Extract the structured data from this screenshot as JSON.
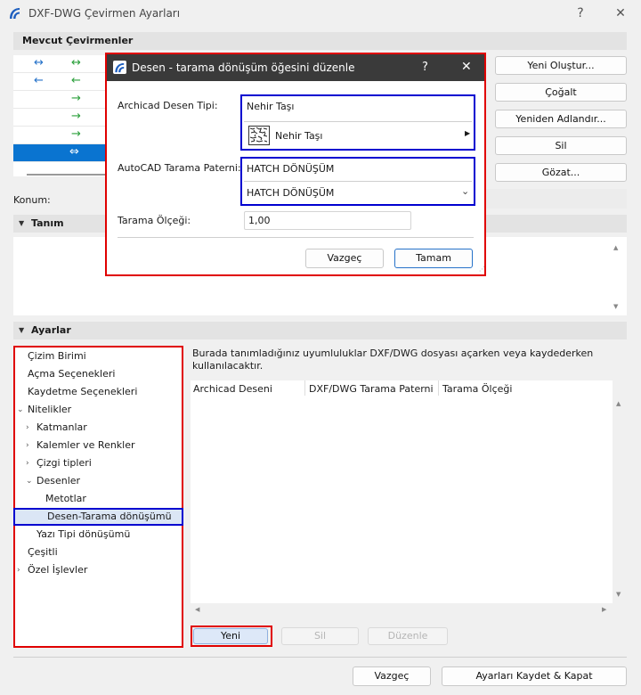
{
  "window": {
    "title": "DXF-DWG Çevirmen Ayarları",
    "help": "?",
    "close": "✕"
  },
  "current_translators": {
    "header": "Mevcut Çevirmenler",
    "rows": [
      {
        "icons": [
          "↔",
          "↔"
        ],
        "colors": [
          "#2672c9",
          "#2ca03c"
        ]
      },
      {
        "icons": [
          "←",
          "←"
        ],
        "colors": [
          "#2672c9",
          "#2ca03c"
        ]
      },
      {
        "icons": [
          "",
          "→"
        ],
        "colors": [
          "",
          "#2ca03c"
        ]
      },
      {
        "icons": [
          "",
          "→"
        ],
        "colors": [
          "",
          "#2ca03c"
        ]
      },
      {
        "icons": [
          "",
          "→"
        ],
        "colors": [
          "",
          "#2ca03c"
        ]
      },
      {
        "icons": [
          "",
          "⇔"
        ],
        "colors": [
          "",
          "#ffffff"
        ]
      }
    ],
    "buttons": {
      "new": "Yeni Oluştur...",
      "duplicate": "Çoğalt",
      "rename": "Yeniden Adlandır...",
      "delete": "Sil",
      "browse": "Gözat..."
    }
  },
  "location_label": "Konum:",
  "definition": {
    "header": "Tanım"
  },
  "settings": {
    "header": "Ayarlar",
    "nav": [
      {
        "label": "Çizim Birimi",
        "indent": 0,
        "chev": ""
      },
      {
        "label": "Açma Seçenekleri",
        "indent": 0,
        "chev": ""
      },
      {
        "label": "Kaydetme Seçenekleri",
        "indent": 0,
        "chev": ""
      },
      {
        "label": "Nitelikler",
        "indent": 0,
        "chev": "⌄"
      },
      {
        "label": "Katmanlar",
        "indent": 1,
        "chev": "›"
      },
      {
        "label": "Kalemler ve Renkler",
        "indent": 1,
        "chev": "›"
      },
      {
        "label": "Çizgi tipleri",
        "indent": 1,
        "chev": "›"
      },
      {
        "label": "Desenler",
        "indent": 1,
        "chev": "⌄"
      },
      {
        "label": "Metotlar",
        "indent": 2,
        "chev": ""
      },
      {
        "label": "Desen-Tarama dönüşümü",
        "indent": 2,
        "chev": ""
      },
      {
        "label": "Yazı Tipi dönüşümü",
        "indent": 1,
        "chev": ""
      },
      {
        "label": "Çeşitli",
        "indent": 0,
        "chev": ""
      },
      {
        "label": "Özel İşlevler",
        "indent": 0,
        "chev": "›"
      }
    ],
    "description": "Burada tanımladığınız uyumluluklar DXF/DWG dosyası açarken veya kaydederken kullanılacaktır.",
    "columns": [
      "Archicad Deseni",
      "DXF/DWG Tarama Paterni",
      "Tarama Ölçeği"
    ],
    "buttons": {
      "new": "Yeni",
      "delete": "Sil",
      "edit": "Düzenle"
    }
  },
  "footer": {
    "cancel": "Vazgeç",
    "save_close": "Ayarları Kaydet & Kapat"
  },
  "dialog": {
    "title": "Desen - tarama dönüşüm öğesini düzenle",
    "help": "?",
    "close": "✕",
    "archicad_label": "Archicad Desen Tipi:",
    "archicad_value": "Nehir Taşı",
    "archicad_picker": "Nehir Taşı",
    "autocad_label": "AutoCAD Tarama Paterni:",
    "autocad_value": "HATCH DÖNÜŞÜM",
    "autocad_select": "HATCH DÖNÜŞÜM",
    "scale_label": "Tarama Ölçeği:",
    "scale_value": "1,00",
    "cancel": "Vazgeç",
    "ok": "Tamam"
  }
}
